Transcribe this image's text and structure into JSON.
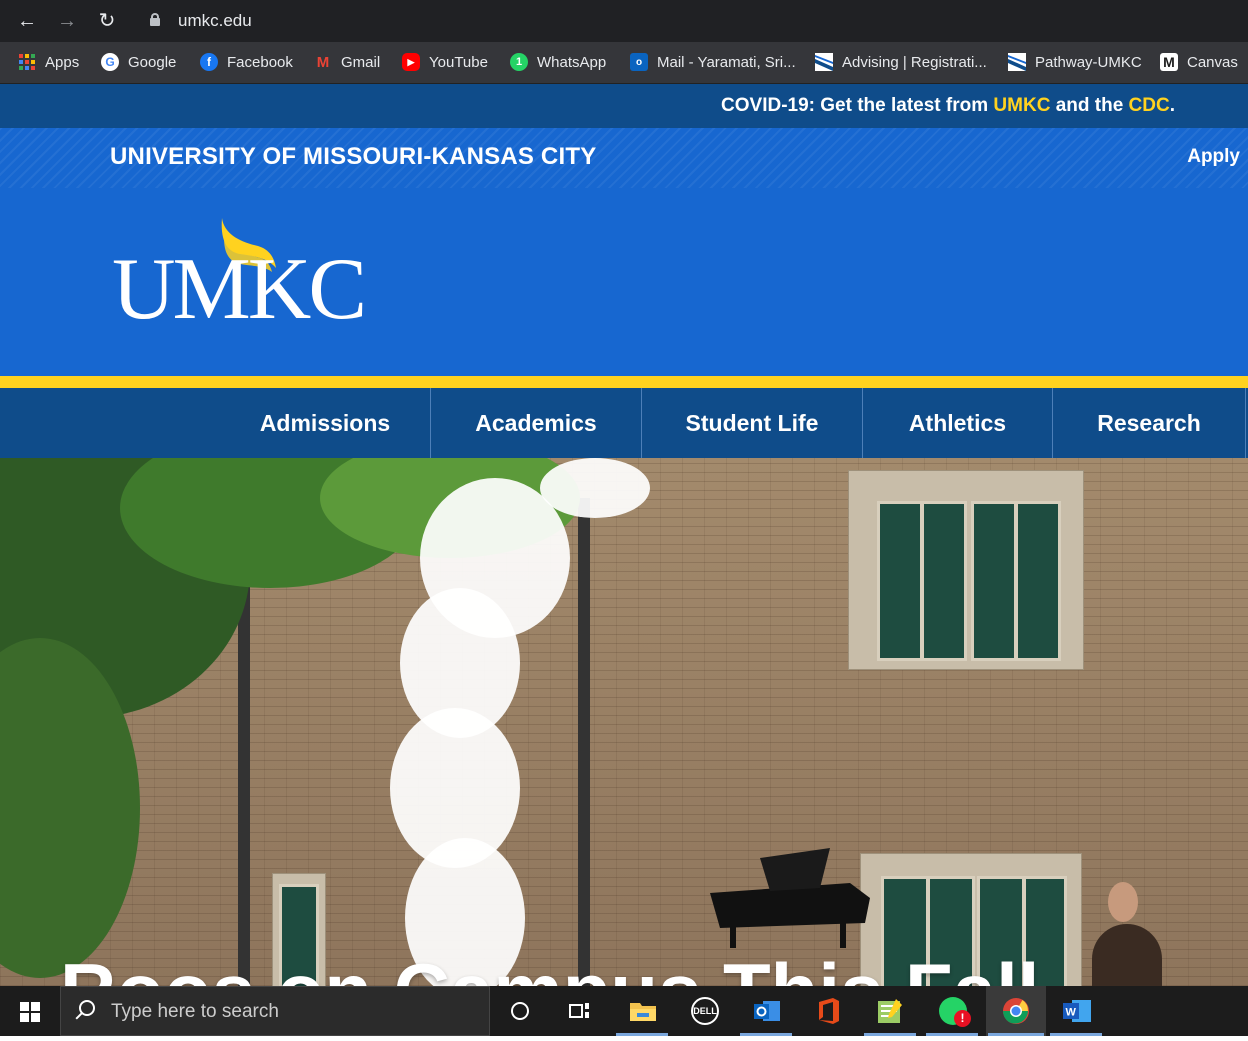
{
  "browser": {
    "url": "umkc.edu",
    "bookmarks": [
      {
        "label": "Apps",
        "icon": "apps-grid-icon",
        "color": "#e8eaed"
      },
      {
        "label": "Google",
        "icon": "google-icon",
        "color": "#ffffff"
      },
      {
        "label": "Facebook",
        "icon": "facebook-icon",
        "color": "#1877f2"
      },
      {
        "label": "Gmail",
        "icon": "gmail-icon",
        "color": "#ea4335"
      },
      {
        "label": "YouTube",
        "icon": "youtube-icon",
        "color": "#ff0000"
      },
      {
        "label": "WhatsApp",
        "icon": "whatsapp-icon",
        "color": "#25d366"
      },
      {
        "label": "Mail - Yaramati, Sri...",
        "icon": "outlook-icon",
        "color": "#0a64c0"
      },
      {
        "label": "Advising | Registrati...",
        "icon": "umkc-bookmark-icon",
        "color": "#ffffff"
      },
      {
        "label": "Pathway-UMKC",
        "icon": "umkc-bookmark-icon",
        "color": "#ffffff"
      },
      {
        "label": "Canvas",
        "icon": "canvas-icon",
        "color": "#ffffff"
      }
    ]
  },
  "alert": {
    "prefix": "COVID-19: Get the latest from ",
    "link1": "UMKC",
    "middle": " and the ",
    "link2": "CDC",
    "suffix": "."
  },
  "header": {
    "university_name": "UNIVERSITY OF MISSOURI-KANSAS CITY",
    "apply_label": "Apply",
    "logo_text": "UMKC"
  },
  "nav": {
    "items": [
      {
        "label": "Admissions"
      },
      {
        "label": "Academics"
      },
      {
        "label": "Student Life"
      },
      {
        "label": "Athletics"
      },
      {
        "label": "Research"
      }
    ]
  },
  "hero": {
    "title": "Roos on Campus This Fall"
  },
  "taskbar": {
    "search_placeholder": "Type here to search",
    "apps": [
      "cortana-icon",
      "task-view-icon",
      "file-explorer-icon",
      "dell-icon",
      "outlook-icon",
      "office-icon",
      "notepad-icon",
      "whatsapp-icon",
      "chrome-icon",
      "word-icon"
    ]
  },
  "colors": {
    "brand_blue": "#1767d0",
    "dark_blue": "#0f4c8a",
    "gold": "#ffd21f"
  }
}
